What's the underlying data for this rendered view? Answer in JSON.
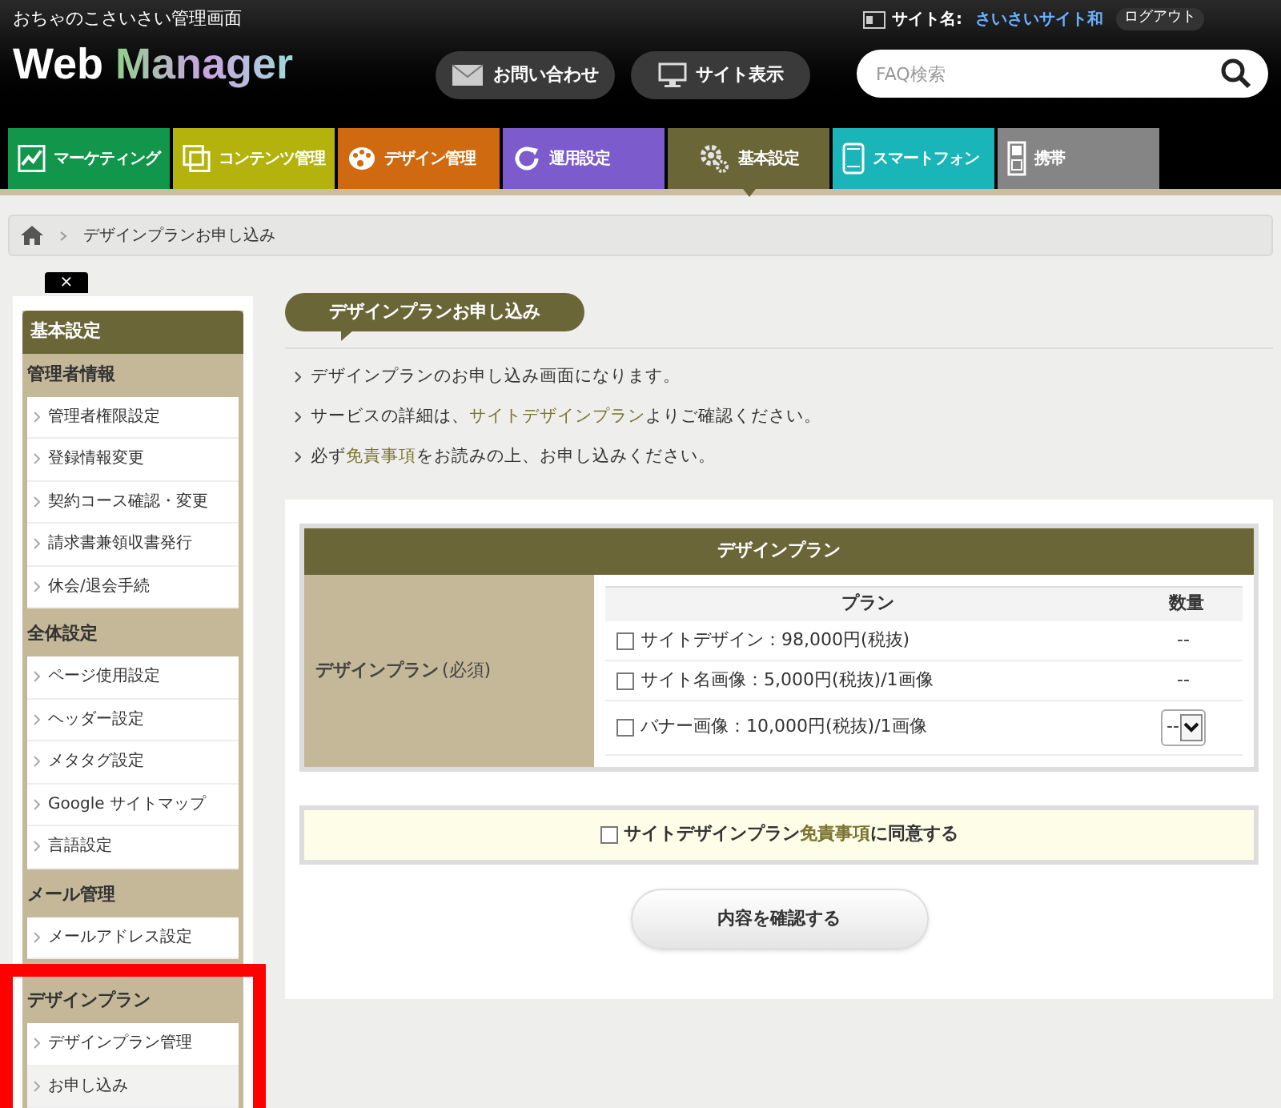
{
  "header": {
    "subtitle": "おちゃのこさいさい管理画面",
    "logo_first": "Web",
    "logo_second": "Manager",
    "site_label": "サイト名:",
    "site_name": "さいさいサイト和",
    "logout": "ログアウト",
    "buttons": [
      {
        "kind": "mail",
        "label": "お問い合わせ"
      },
      {
        "kind": "monitor",
        "label": "サイト表示"
      }
    ],
    "search": {
      "placeholder": "FAQ検索"
    }
  },
  "tabs": [
    {
      "label": "マーケティング",
      "kind": "chart",
      "color": "#12964b",
      "selected": false
    },
    {
      "label": "コンテンツ管理",
      "kind": "pages",
      "color": "#b4b20c",
      "selected": false
    },
    {
      "label": "デザイン管理",
      "kind": "palette",
      "color": "#d06a10",
      "selected": false
    },
    {
      "label": "運用設定",
      "kind": "refresh",
      "color": "#7c5ccc",
      "selected": false
    },
    {
      "label": "基本設定",
      "kind": "gear",
      "color": "#6b6638",
      "selected": true
    },
    {
      "label": "スマートフォン",
      "kind": "phone",
      "color": "#1ab5b8",
      "selected": false
    },
    {
      "label": "携帯",
      "kind": "mobile",
      "color": "#858585",
      "selected": false
    }
  ],
  "breadcrumb": [
    "デザインプランお申し込み"
  ],
  "sidebar": {
    "close": "×",
    "title": "基本設定",
    "sections": [
      {
        "title": "管理者情報",
        "highlighted": false,
        "items": [
          {
            "label": "管理者権限設定",
            "selected": false
          },
          {
            "label": "登録情報変更",
            "selected": false
          },
          {
            "label": "契約コース確認・変更",
            "selected": false
          },
          {
            "label": "請求書兼領収書発行",
            "selected": false
          },
          {
            "label": "休会/退会手続",
            "selected": false
          }
        ]
      },
      {
        "title": "全体設定",
        "highlighted": false,
        "items": [
          {
            "label": "ページ使用設定",
            "selected": false
          },
          {
            "label": "ヘッダー設定",
            "selected": false
          },
          {
            "label": "メタタグ設定",
            "selected": false
          },
          {
            "label": "Google サイトマップ",
            "selected": false
          },
          {
            "label": "言語設定",
            "selected": false
          }
        ]
      },
      {
        "title": "メール管理",
        "highlighted": false,
        "items": [
          {
            "label": "メールアドレス設定",
            "selected": false
          }
        ]
      },
      {
        "title": "デザインプラン",
        "highlighted": true,
        "items": [
          {
            "label": "デザインプラン管理",
            "selected": false
          },
          {
            "label": "お申し込み",
            "selected": true
          }
        ]
      }
    ]
  },
  "main": {
    "heading": "デザインプランお申し込み",
    "notes": [
      [
        {
          "text": "デザインプランのお申し込み画面になります。",
          "link": false
        }
      ],
      [
        {
          "text": "サービスの詳細は、",
          "link": false
        },
        {
          "text": "サイトデザインプラン",
          "link": true
        },
        {
          "text": "よりご確認ください。",
          "link": false
        }
      ],
      [
        {
          "text": "必ず",
          "link": false
        },
        {
          "text": "免責事項",
          "link": true
        },
        {
          "text": "をお読みの上、お申し込みください。",
          "link": false
        }
      ]
    ],
    "form": {
      "title": "デザインプラン",
      "label": "デザインプラン",
      "required": "(必須)",
      "columns": [
        "プラン",
        "数量"
      ],
      "rows": [
        {
          "label": "サイトデザイン：98,000円(税抜)",
          "checked": false,
          "kind": "text",
          "quantity": "--"
        },
        {
          "label": "サイト名画像：5,000円(税抜)/1画像",
          "checked": false,
          "kind": "text",
          "quantity": "--"
        },
        {
          "label": "バナー画像：10,000円(税抜)/1画像",
          "checked": false,
          "kind": "select",
          "quantity": "--"
        }
      ]
    },
    "agree": {
      "checked": false,
      "parts": [
        {
          "text": "サイトデザインプラン",
          "link": false
        },
        {
          "text": "免責事項",
          "link": true
        },
        {
          "text": "に同意する",
          "link": false
        }
      ]
    },
    "confirm": "内容を確認する"
  }
}
